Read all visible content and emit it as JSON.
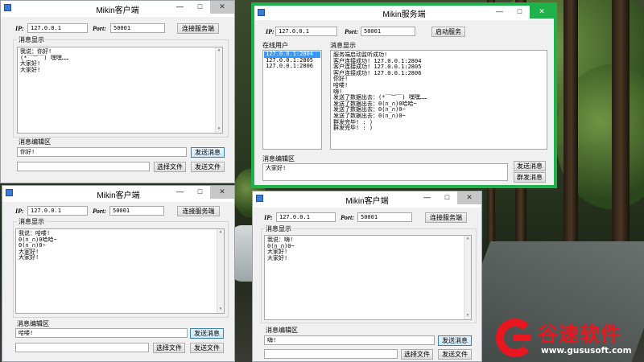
{
  "client_common": {
    "title": "Mikin客户端",
    "ip_label": "IP:",
    "port_label": "Port:",
    "ip_value": "127.0.0.1",
    "port_value": "50001",
    "connect_button": "连接服务端",
    "messages_group": "消息显示",
    "edit_group": "消息编辑区",
    "send_button": "发送消息",
    "choose_file_button": "选择文件",
    "send_file_button": "发送文件"
  },
  "client1": {
    "messages": [
      "我说：你好!",
      "(*￣︶￣) 嘿嘿……",
      "大家好!",
      "大家好!"
    ],
    "input_text": "你好!"
  },
  "client2": {
    "messages": [
      "我说：哈喽!",
      "0(∩_∩)0哈哈~",
      "0(∩_∩)0~",
      "大家好!",
      "大家好!"
    ],
    "input_text": "哈喽!"
  },
  "client3": {
    "messages": [
      "我说：嗨!",
      "0(∩_∩)0~",
      "大家好!",
      "大家好!"
    ],
    "input_text": "嗨!"
  },
  "server": {
    "title": "Mikin服务端",
    "ip_label": "IP:",
    "port_label": "Port:",
    "ip_value": "127.0.0.1",
    "port_value": "50001",
    "start_button": "启动服务",
    "users_group": "在线用户",
    "messages_group": "消息显示",
    "users": [
      "127.0.0.1:2804",
      "127.0.0.1:2805",
      "127.0.0.1:2806"
    ],
    "messages": [
      "服务端启动监听成功!",
      "客户连接成功! 127.0.0.1:2804",
      "客户连接成功! 127.0.0.1:2805",
      "客户连接成功! 127.0.0.1:2806",
      "你好!",
      "哈喽!",
      "嗨!",
      "发送了数据出去：(*￣︶￣) 嘿嘿……",
      "发送了数据出去：0(∩_∩)0哈哈~",
      "发送了数据出去：0(∩_∩)0~",
      "发送了数据出去：0(∩_∩)0~",
      "群发完毕! : )",
      "群发完毕! : )"
    ],
    "edit_group": "消息编辑区",
    "input_text": "大家好!",
    "send_button": "发送消息",
    "broadcast_button": "群发消息"
  },
  "watermark": {
    "brand": "谷速软件",
    "url": "www.gususoft.com"
  },
  "window_controls": {
    "minimize": "—",
    "maximize": "□",
    "close": "✕"
  },
  "colors": {
    "server_border": "#1fb14a",
    "selection": "#3399ff",
    "logo": "#e8161e"
  }
}
